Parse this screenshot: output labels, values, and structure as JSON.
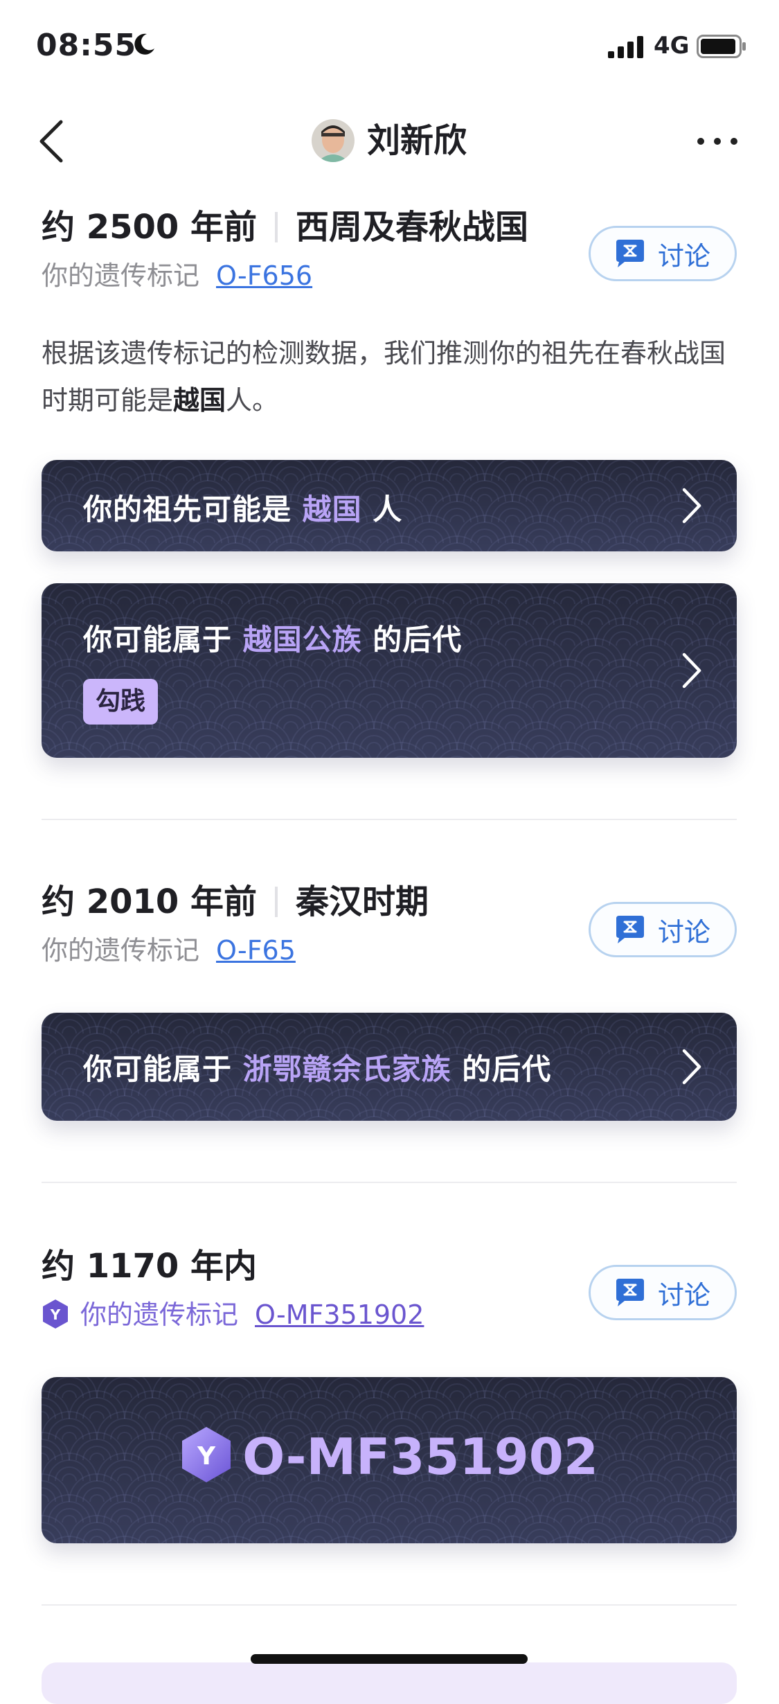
{
  "status_bar": {
    "time": "08:55",
    "network": "4G"
  },
  "nav": {
    "title": "刘新欣"
  },
  "sections": [
    {
      "age": "约 2500 年前",
      "era": "西周及春秋战国",
      "marker_label": "你的遗传标记",
      "marker": "O-F656",
      "discuss": "讨论",
      "description_pre": "根据该遗传标记的检测数据，我们推测你的祖先在春秋战国时期可能是",
      "description_bold": "越国",
      "description_post": "人。",
      "cards": [
        {
          "pre": "你的祖先可能是",
          "highlight": "越国",
          "post": "人"
        },
        {
          "pre": "你可能属于",
          "highlight": "越国公族",
          "post": "的后代",
          "tag": "勾践"
        }
      ]
    },
    {
      "age": "约 2010 年前",
      "era": "秦汉时期",
      "marker_label": "你的遗传标记",
      "marker": "O-F65",
      "discuss": "讨论",
      "cards": [
        {
          "pre": "你可能属于",
          "highlight": "浙鄂赣余氏家族",
          "post": "的后代"
        }
      ]
    },
    {
      "age": "约 1170 年内",
      "marker_badge": "Y",
      "marker_label": "你的遗传标记",
      "marker": "O-MF351902",
      "discuss": "讨论",
      "big_card": {
        "badge": "Y",
        "code": "O-MF351902"
      }
    }
  ],
  "colors": {
    "accent_blue": "#3b74e0",
    "highlight_purple": "#b9a4f6",
    "card_dark": "#2b2f45"
  }
}
